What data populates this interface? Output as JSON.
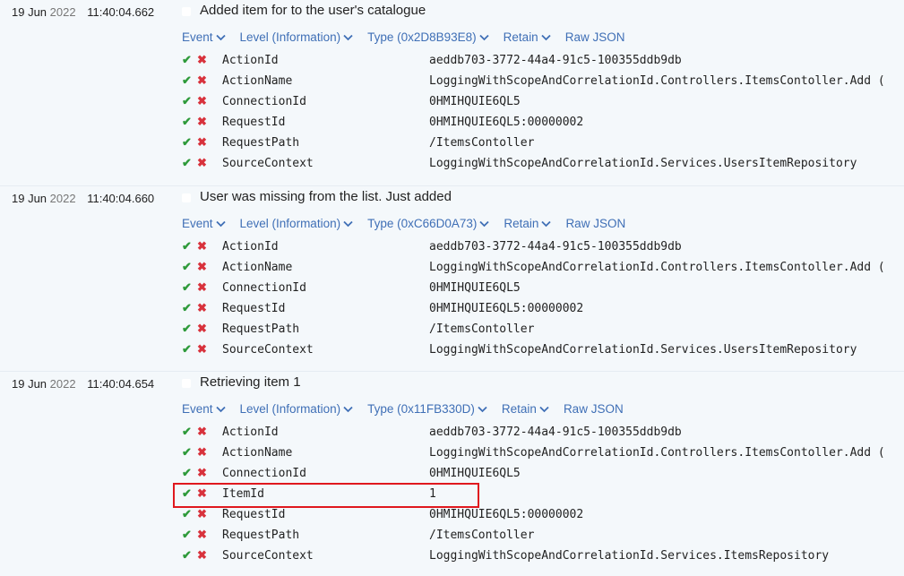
{
  "events": [
    {
      "date": "19 Jun",
      "year": "2022",
      "time": "11:40:04.662",
      "message": "Added item for to the user's catalogue",
      "toolbar": [
        "Event",
        "Level (Information)",
        "Type (0x2D8B93E8)",
        "Retain",
        "Raw JSON"
      ],
      "props": [
        {
          "key": "ActionId",
          "value": "aeddb703-3772-44a4-91c5-100355ddb9db"
        },
        {
          "key": "ActionName",
          "value": "LoggingWithScopeAndCorrelationId.Controllers.ItemsContoller.Add ("
        },
        {
          "key": "ConnectionId",
          "value": "0HMIHQUIE6QL5"
        },
        {
          "key": "RequestId",
          "value": "0HMIHQUIE6QL5:00000002"
        },
        {
          "key": "RequestPath",
          "value": "/ItemsContoller"
        },
        {
          "key": "SourceContext",
          "value": "LoggingWithScopeAndCorrelationId.Services.UsersItemRepository"
        }
      ]
    },
    {
      "date": "19 Jun",
      "year": "2022",
      "time": "11:40:04.660",
      "message": "User was missing from the list. Just added",
      "toolbar": [
        "Event",
        "Level (Information)",
        "Type (0xC66D0A73)",
        "Retain",
        "Raw JSON"
      ],
      "props": [
        {
          "key": "ActionId",
          "value": "aeddb703-3772-44a4-91c5-100355ddb9db"
        },
        {
          "key": "ActionName",
          "value": "LoggingWithScopeAndCorrelationId.Controllers.ItemsContoller.Add ("
        },
        {
          "key": "ConnectionId",
          "value": "0HMIHQUIE6QL5"
        },
        {
          "key": "RequestId",
          "value": "0HMIHQUIE6QL5:00000002"
        },
        {
          "key": "RequestPath",
          "value": "/ItemsContoller"
        },
        {
          "key": "SourceContext",
          "value": "LoggingWithScopeAndCorrelationId.Services.UsersItemRepository"
        }
      ]
    },
    {
      "date": "19 Jun",
      "year": "2022",
      "time": "11:40:04.654",
      "message": "Retrieving item 1",
      "toolbar": [
        "Event",
        "Level (Information)",
        "Type (0x11FB330D)",
        "Retain",
        "Raw JSON"
      ],
      "props": [
        {
          "key": "ActionId",
          "value": "aeddb703-3772-44a4-91c5-100355ddb9db"
        },
        {
          "key": "ActionName",
          "value": "LoggingWithScopeAndCorrelationId.Controllers.ItemsContoller.Add ("
        },
        {
          "key": "ConnectionId",
          "value": "0HMIHQUIE6QL5"
        },
        {
          "key": "ItemId",
          "value": "1"
        },
        {
          "key": "RequestId",
          "value": "0HMIHQUIE6QL5:00000002"
        },
        {
          "key": "RequestPath",
          "value": "/ItemsContoller"
        },
        {
          "key": "SourceContext",
          "value": "LoggingWithScopeAndCorrelationId.Services.ItemsRepository"
        }
      ]
    }
  ],
  "icons": {
    "include": "✔",
    "exclude": "✖",
    "chevron": "chevron-down-icon"
  },
  "colors": {
    "link": "#3f6fb6",
    "include": "#2e9a3a",
    "exclude": "#d8323c",
    "highlight": "#e0181e"
  }
}
